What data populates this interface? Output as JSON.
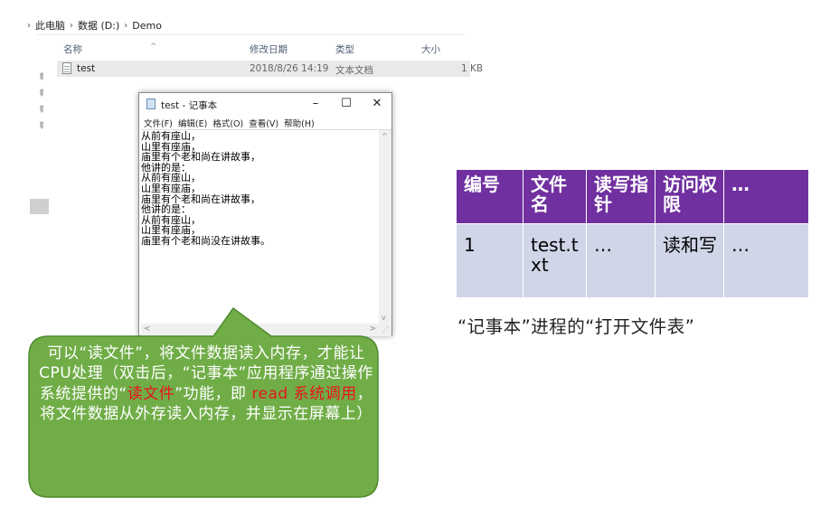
{
  "explorer": {
    "breadcrumb": [
      "›",
      "此电脑",
      "数据 (D:)",
      "Demo"
    ],
    "columns": {
      "name": "名称",
      "modified": "修改日期",
      "type": "类型",
      "size": "大小"
    },
    "file": {
      "name": "test",
      "modified": "2018/8/26 14:19",
      "type": "文本文档",
      "size": "1 KB"
    }
  },
  "notepad": {
    "title": "test - 记事本",
    "window_buttons": {
      "minimize": "–",
      "maximize": "☐",
      "close": "✕"
    },
    "menu": [
      "文件(F)",
      "编辑(E)",
      "格式(O)",
      "查看(V)",
      "帮助(H)"
    ],
    "content": "从前有座山，\n山里有座庙，\n庙里有个老和尚在讲故事，\n他讲的是：\n从前有座山，\n山里有座庙，\n庙里有个老和尚在讲故事，\n他讲的是：\n从前有座山，\n山里有座庙，\n庙里有个老和尚没在讲故事。"
  },
  "callout": {
    "part1": "可以“读文件”，将文件数据读入内存，才能让CPU处理（双击后，“记事本”应用程序通过操作系统提供的“",
    "highlight1": "读文件",
    "part2": "”功能，即 ",
    "highlight2": "read 系统调用",
    "part3": "，将文件数据从外存读入内存，并显示在屏幕上）",
    "fill_color": "#70ad47",
    "border_color": "#4e8a30",
    "highlight_color": "#e8141e"
  },
  "file_table": {
    "headers": [
      "编号",
      "文件名",
      "读写指针",
      "访问权限",
      "…"
    ],
    "row": [
      "1",
      "test.txt",
      "…",
      "读和写",
      "…"
    ],
    "header_color": "#7030a0",
    "cell_color": "#d0d5e8"
  },
  "caption": "“记事本”进程的“打开文件表”"
}
